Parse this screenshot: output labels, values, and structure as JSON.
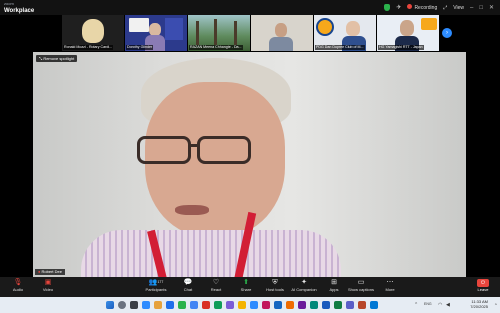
{
  "window": {
    "brand_top": "zoom",
    "brand_name": "Workplace"
  },
  "titlebar": {
    "recording": "Recording",
    "view": "View"
  },
  "thumbnails": [
    {
      "name": "Ronald Mozzi - Rotary Cardi..."
    },
    {
      "name": "Dorothy Glinder"
    },
    {
      "name": "RAZAN Meena Chhangte - Da..."
    },
    {
      "name": ""
    },
    {
      "name": "PDG Dan Dupree Club of M..."
    },
    {
      "name": "HG Yamagishi RTT - Japan"
    }
  ],
  "main": {
    "spotlight_label": "Remove spotlight",
    "speaker_name": "Robert Dee"
  },
  "toolbar": {
    "audio": "Audio",
    "video": "Video",
    "participants": "Participants",
    "participants_count": "177",
    "chat": "Chat",
    "react": "React",
    "share": "Share",
    "host_tools": "Host tools",
    "ai_companion": "AI Companion",
    "apps": "Apps",
    "show_captions": "Show captions",
    "more": "More",
    "leave": "Leave"
  },
  "taskbar": {
    "time": "11:33 AM",
    "date": "7/20/2025",
    "lang": "ENG"
  },
  "colors": {
    "zoom_blue": "#2d8cff",
    "leave_red": "#e8453c",
    "secure_green": "#2bb24c"
  }
}
